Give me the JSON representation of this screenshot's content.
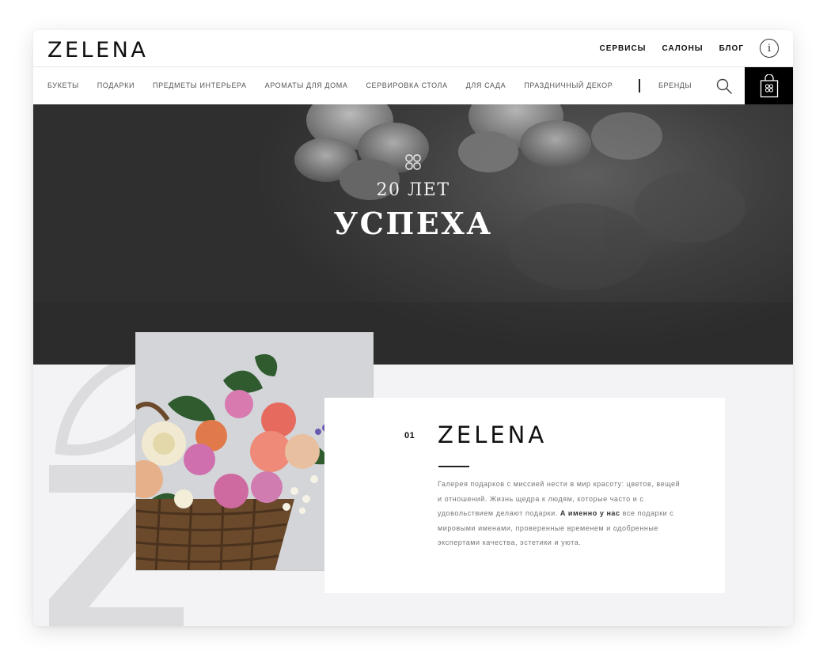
{
  "header": {
    "logo": "ZELENA",
    "links": [
      "СЕРВИСЫ",
      "САЛОНЫ",
      "БЛОГ"
    ],
    "info_icon": "info-icon"
  },
  "nav": {
    "categories": [
      "БУКЕТЫ",
      "ПОДАРКИ",
      "ПРЕДМЕТЫ ИНТЕРЬЕРА",
      "АРОМАТЫ ДЛЯ ДОМА",
      "СЕРВИРОВКА СТОЛА",
      "ДЛЯ САДА",
      "ПРАЗДНИЧНЫЙ ДЕКОР"
    ],
    "brands": "БРЕНДЫ",
    "search_icon": "search-icon",
    "cart_icon": "shopping-bag-icon"
  },
  "hero": {
    "subtitle": "20 ЛЕТ",
    "title": "УСПЕХА",
    "emblem_icon": "clover-icon"
  },
  "about": {
    "number": "01",
    "title": "ZELENA",
    "text_before_bold": "Галерея подарков с миссией нести в мир красоту: цветов, вещей и отношений. Жизнь щедра к людям, которые часто и с удовольствием делают подарки.",
    "text_bold": "А именно у нас",
    "text_after_bold": "все подарки с мировыми именами, проверенные временем и одобренные экспертами качества, эстетики и уюта."
  },
  "colors": {
    "accent": "#000000",
    "background": "#f3f2f4",
    "hero_dark": "#3a3a3a",
    "deco_letters": "#dcdbdd"
  }
}
